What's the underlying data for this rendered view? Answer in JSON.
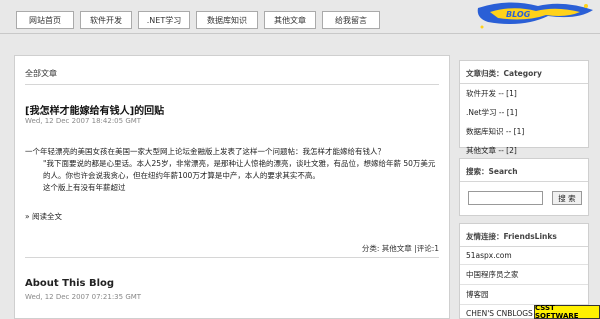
{
  "nav": {
    "items": [
      "网站首页",
      "软件开发",
      ".NET学习",
      "数据库知识",
      "其他文章",
      "给我留言"
    ]
  },
  "main": {
    "category_title": "全部文章",
    "post1": {
      "title": "[我怎样才能嫁给有钱人]的回贴",
      "date": "Wed, 12 Dec 2007 18:42:05 GMT",
      "body_line1": "一个年轻漂亮的美国女孩在美国一家大型网上论坛金融版上发表了这样一个问题帖：我怎样才能嫁给有钱人？",
      "body_line2": "\"我下面要说的都是心里话。本人25岁，非常漂亮，是那种让人惊艳的漂亮，谈吐文雅，有品位，想嫁给年薪 50万美元的人。你也许会说我贪心，但在纽约年薪100万才算是中产，本人的要求其实不高。",
      "body_line3": "这个版上有没有年薪超过",
      "read_more": "» 阅读全文",
      "meta_prefix": "分类:",
      "meta_category": "其他文章",
      "meta_comments": "|评论:1"
    },
    "post2": {
      "title": "About This Blog",
      "date": "Wed, 12 Dec 2007 07:21:35 GMT"
    }
  },
  "sidebar": {
    "category_heading": "文章归类：Category",
    "categories": [
      "软件开发 -- [1]",
      ".Net学习 -- [1]",
      "数据库知识 -- [1]",
      "其他文章 -- [2]"
    ],
    "search_heading": "搜索：Search",
    "search_button": "搜 索",
    "search_value": "",
    "links_heading": "友情连接：FriendsLinks",
    "links": [
      "51aspx.com",
      "中国程序员之家",
      "博客园",
      "CHEN'S CNBLOGS"
    ]
  },
  "badge": "CSST SOFTWARE",
  "colors": {
    "logo_blue": "#2a5fd6",
    "logo_yellow": "#ffd21a",
    "badge_bg": "#fff000"
  }
}
